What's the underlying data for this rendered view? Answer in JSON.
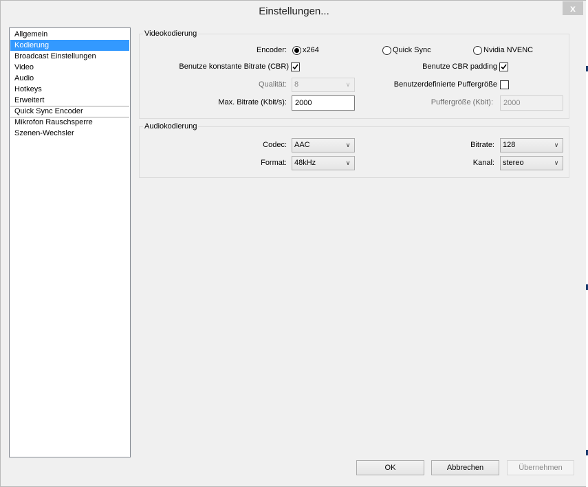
{
  "window": {
    "title": "Einstellungen...",
    "close_symbol": "x"
  },
  "sidebar": {
    "items": [
      {
        "label": "Allgemein",
        "selected": false
      },
      {
        "label": "Kodierung",
        "selected": true
      },
      {
        "label": "Broadcast Einstellungen",
        "selected": false
      },
      {
        "label": "Video",
        "selected": false
      },
      {
        "label": "Audio",
        "selected": false
      },
      {
        "label": "Hotkeys",
        "selected": false
      },
      {
        "label": "Erweitert",
        "selected": false
      },
      {
        "label": "Quick Sync Encoder",
        "selected": false
      },
      {
        "label": "Mikrofon Rauschsperre",
        "selected": false
      },
      {
        "label": "Szenen-Wechsler",
        "selected": false
      }
    ]
  },
  "video": {
    "legend": "Videokodierung",
    "encoder_label": "Encoder:",
    "encoder_options": [
      {
        "label": "x264",
        "checked": true
      },
      {
        "label": "Quick Sync",
        "checked": false
      },
      {
        "label": "Nvidia NVENC",
        "checked": false
      }
    ],
    "cbr_label": "Benutze konstante Bitrate (CBR)",
    "cbr_checked": true,
    "cbr_padding_label": "Benutze CBR padding",
    "cbr_padding_checked": true,
    "quality_label": "Qualität:",
    "quality_value": "8",
    "custom_buffer_label": "Benutzerdefinierte Puffergröße",
    "custom_buffer_checked": false,
    "max_bitrate_label": "Max. Bitrate (Kbit/s):",
    "max_bitrate_value": "2000",
    "buffer_size_label": "Puffergröße (Kbit):",
    "buffer_size_value": "2000"
  },
  "audio": {
    "legend": "Audiokodierung",
    "codec_label": "Codec:",
    "codec_value": "AAC",
    "bitrate_label": "Bitrate:",
    "bitrate_value": "128",
    "format_label": "Format:",
    "format_value": "48kHz",
    "channel_label": "Kanal:",
    "channel_value": "stereo"
  },
  "buttons": {
    "ok": "OK",
    "cancel": "Abbrechen",
    "apply": "Übernehmen"
  }
}
